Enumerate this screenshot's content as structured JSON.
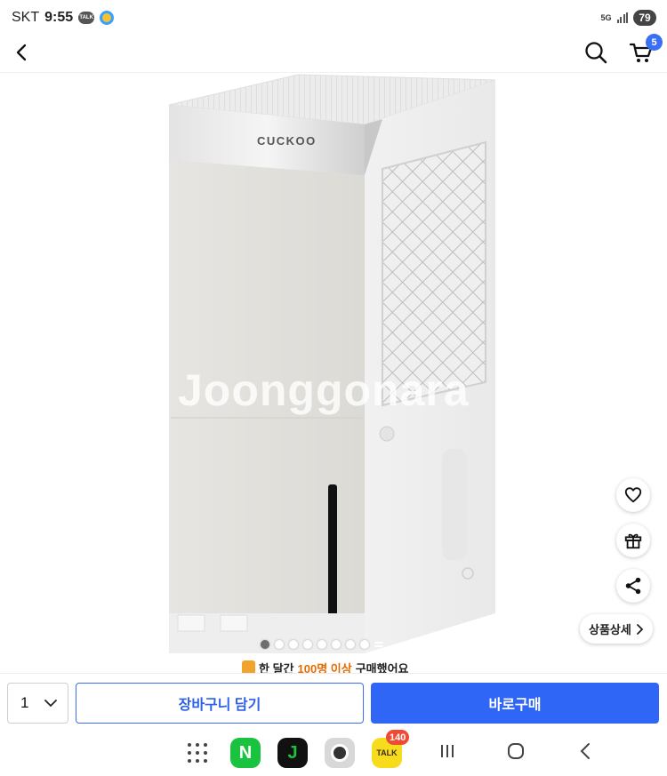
{
  "status_bar": {
    "carrier": "SKT",
    "time": "9:55",
    "notification_talk": "TALK",
    "network": "5G",
    "battery": "79"
  },
  "header": {
    "cart_count": "5"
  },
  "product_image": {
    "brand_label": "CUCKOO",
    "watermark": "Joonggonara",
    "slide_count": 8,
    "active_slide": 1
  },
  "floating": {
    "detail_label": "상품상세"
  },
  "buyer_notice": {
    "prefix": "한 달간",
    "highlight": "100명 이상",
    "suffix": "구매했어요"
  },
  "purchase_bar": {
    "quantity": "1",
    "cart_add_label": "장바구니 담기",
    "buy_now_label": "바로구매"
  },
  "nav_bar": {
    "naver_letter": "N",
    "jungna_letter": "J",
    "kakao_label": "TALK",
    "kakao_badge": "140"
  },
  "colors": {
    "accent_blue": "#2f66f6",
    "highlight_orange": "#e46b00"
  }
}
